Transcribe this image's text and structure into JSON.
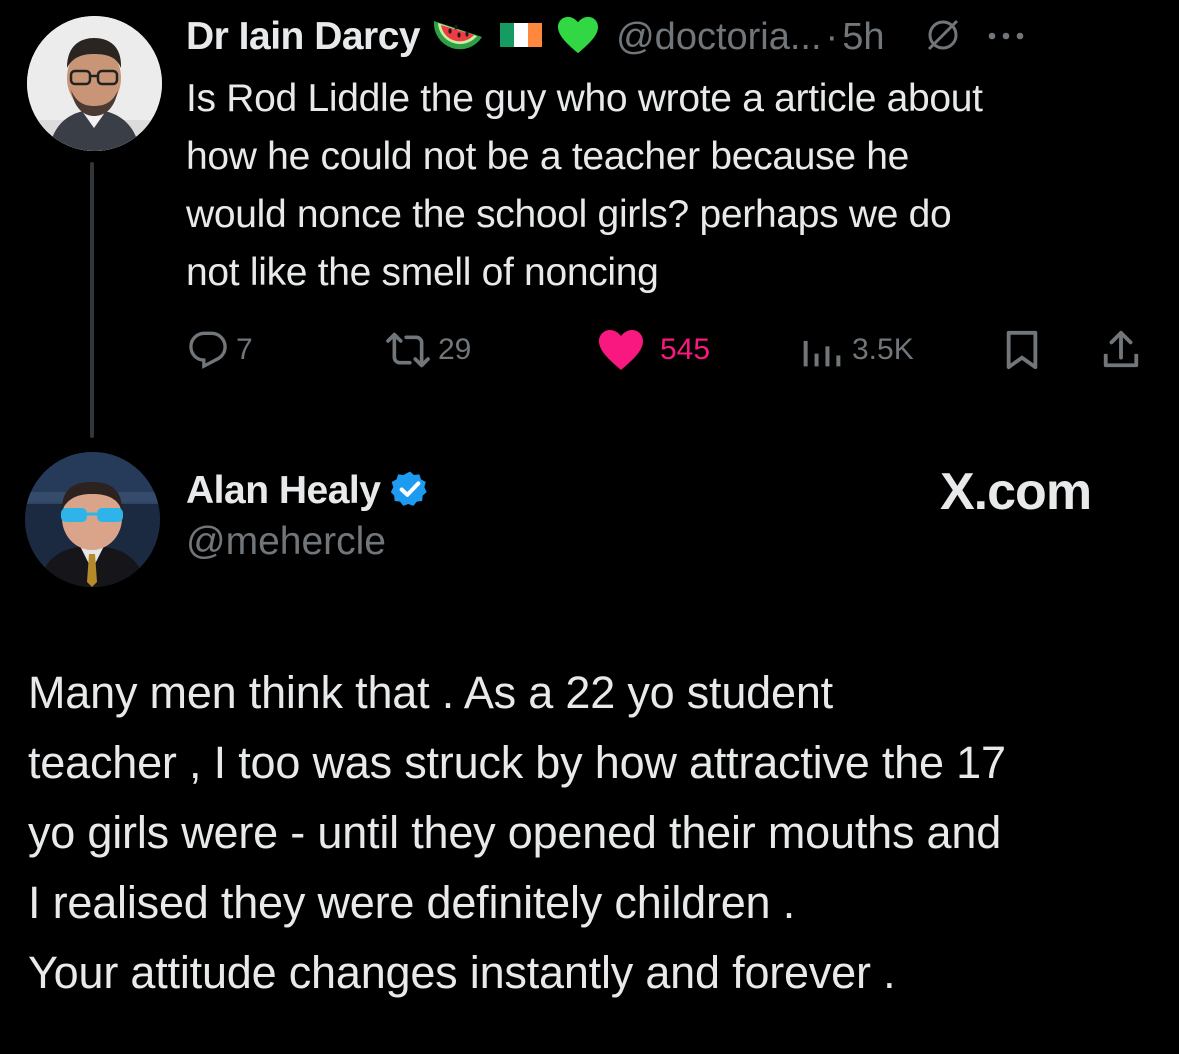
{
  "tweet1": {
    "author_name": "Dr Iain Darcy",
    "handle": "@doctoria...",
    "separator": "·",
    "time": "5h",
    "text_lines": [
      "Is Rod Liddle the guy who wrote a article about",
      "how he could not be a teacher because he",
      "would nonce the school girls? perhaps we do",
      "not like the smell of noncing"
    ],
    "name_emojis": [
      "watermelon-icon",
      "ireland-flag-icon",
      "green-heart-icon"
    ],
    "stats": {
      "replies": "7",
      "reposts": "29",
      "likes": "545",
      "views": "3.5K"
    }
  },
  "tweet2": {
    "author_name": "Alan Healy",
    "handle": "@mehercle",
    "verified": true,
    "watermark": "X.com",
    "text_lines": [
      "Many men think that . As a 22 yo student",
      "teacher , I too was struck by how attractive the 17",
      "yo girls were - until they opened their mouths and",
      "I realised they were definitely children .",
      "Your attitude changes instantly and forever ."
    ]
  },
  "colors": {
    "background": "#000000",
    "text": "#e7e9ea",
    "muted": "#71767b",
    "like": "#f91880",
    "verified": "#1d9bf0",
    "thread_line": "#333639"
  }
}
